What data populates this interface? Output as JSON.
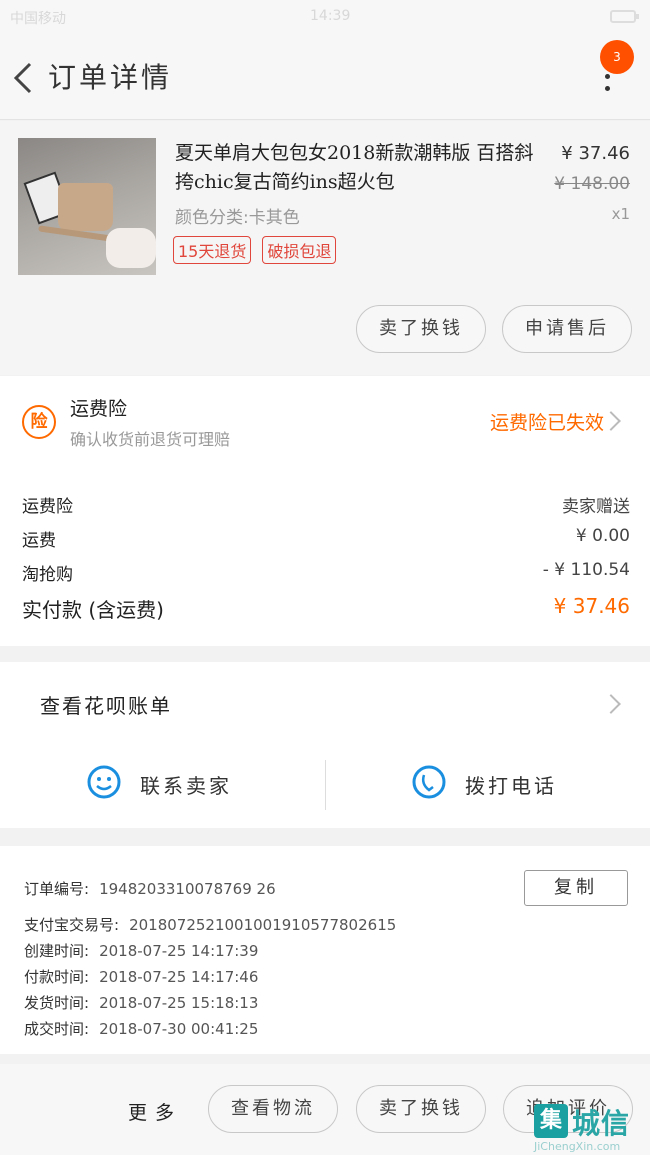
{
  "status_bar": {
    "carrier": "中国移动",
    "time": "14:39"
  },
  "nav": {
    "title": "订单详情",
    "badge_count": "3"
  },
  "product": {
    "title": "夏天单肩大包包女2018新款潮韩版 百搭斜挎chic复古简约ins超火包",
    "spec": "颜色分类:卡其色",
    "tags": [
      "15天退货",
      "破损包退"
    ],
    "price": "¥ 37.46",
    "original_price": "¥ 148.00",
    "quantity": "x1",
    "buttons": {
      "sell": "卖了换钱",
      "after_sale": "申请售后"
    }
  },
  "insurance": {
    "icon_text": "险",
    "title": "运费险",
    "subtitle": "确认收货前退货可理赔",
    "status": "运费险已失效"
  },
  "fees": [
    {
      "label": "运费险",
      "value": "卖家赠送"
    },
    {
      "label": "运费",
      "value": "¥ 0.00"
    },
    {
      "label": "淘抢购",
      "value": "- ¥ 110.54"
    }
  ],
  "total": {
    "label": "实付款 (含运费)",
    "value": "¥ 37.46"
  },
  "huabei": {
    "label": "查看花呗账单"
  },
  "contact": {
    "seller": "联系卖家",
    "call": "拨打电话"
  },
  "order_info": {
    "order_no": {
      "label": "订单编号:",
      "value": "1948203310078769 26"
    },
    "alipay_no": {
      "label": "支付宝交易号:",
      "value": "2018072521001001910577802615"
    },
    "created": {
      "label": "创建时间:",
      "value": "2018-07-25 14:17:39"
    },
    "paid": {
      "label": "付款时间:",
      "value": "2018-07-25 14:17:46"
    },
    "shipped": {
      "label": "发货时间:",
      "value": "2018-07-25 15:18:13"
    },
    "completed": {
      "label": "成交时间:",
      "value": "2018-07-30 00:41:25"
    },
    "copy_label": "复制"
  },
  "bottom": {
    "more": "更多",
    "logistics": "查看物流",
    "sell": "卖了换钱",
    "review": "追加评价"
  },
  "watermark": {
    "mark": "集",
    "text": "城信",
    "url": "JiChengXin.com"
  },
  "colors": {
    "accent": "#ff6a00",
    "badge": "#ff5000",
    "tag": "#e0463b",
    "contact_icon": "#1a8fe0"
  }
}
